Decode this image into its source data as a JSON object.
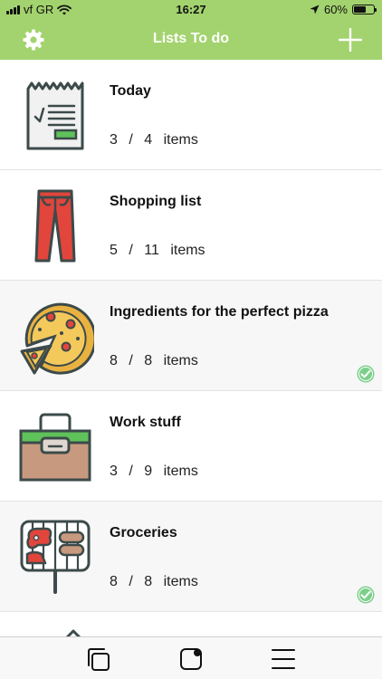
{
  "status_bar": {
    "carrier": "vf GR",
    "time": "16:27",
    "battery": "60%",
    "battery_level": 0.6
  },
  "nav": {
    "title": "Lists To do",
    "left_icon": "gear-icon",
    "right_icon": "plus-icon"
  },
  "lists": [
    {
      "title": "Today",
      "done": "3",
      "total": "4",
      "unit": "items",
      "icon": "receipt-icon",
      "completed": false
    },
    {
      "title": "Shopping list",
      "done": "5",
      "total": "11",
      "unit": "items",
      "icon": "pants-icon",
      "completed": false
    },
    {
      "title": "Ingredients for the perfect pizza",
      "done": "8",
      "total": "8",
      "unit": "items",
      "icon": "pizza-icon",
      "completed": true
    },
    {
      "title": "Work stuff",
      "done": "3",
      "total": "9",
      "unit": "items",
      "icon": "toolbox-icon",
      "completed": false
    },
    {
      "title": "Groceries",
      "done": "8",
      "total": "8",
      "unit": "items",
      "icon": "grill-icon",
      "completed": true
    }
  ],
  "colors": {
    "accent": "#a3d36e",
    "check": "#7ccf8a",
    "icon_stroke": "#3c4a4a",
    "red": "#e2453c",
    "pizza_crust": "#e9b240",
    "box_brown": "#c79a7f",
    "box_green": "#5fc25a"
  },
  "tab_bar": {
    "tabs": [
      "lists-tab-icon",
      "notes-tab-icon",
      "menu-tab-icon"
    ]
  }
}
